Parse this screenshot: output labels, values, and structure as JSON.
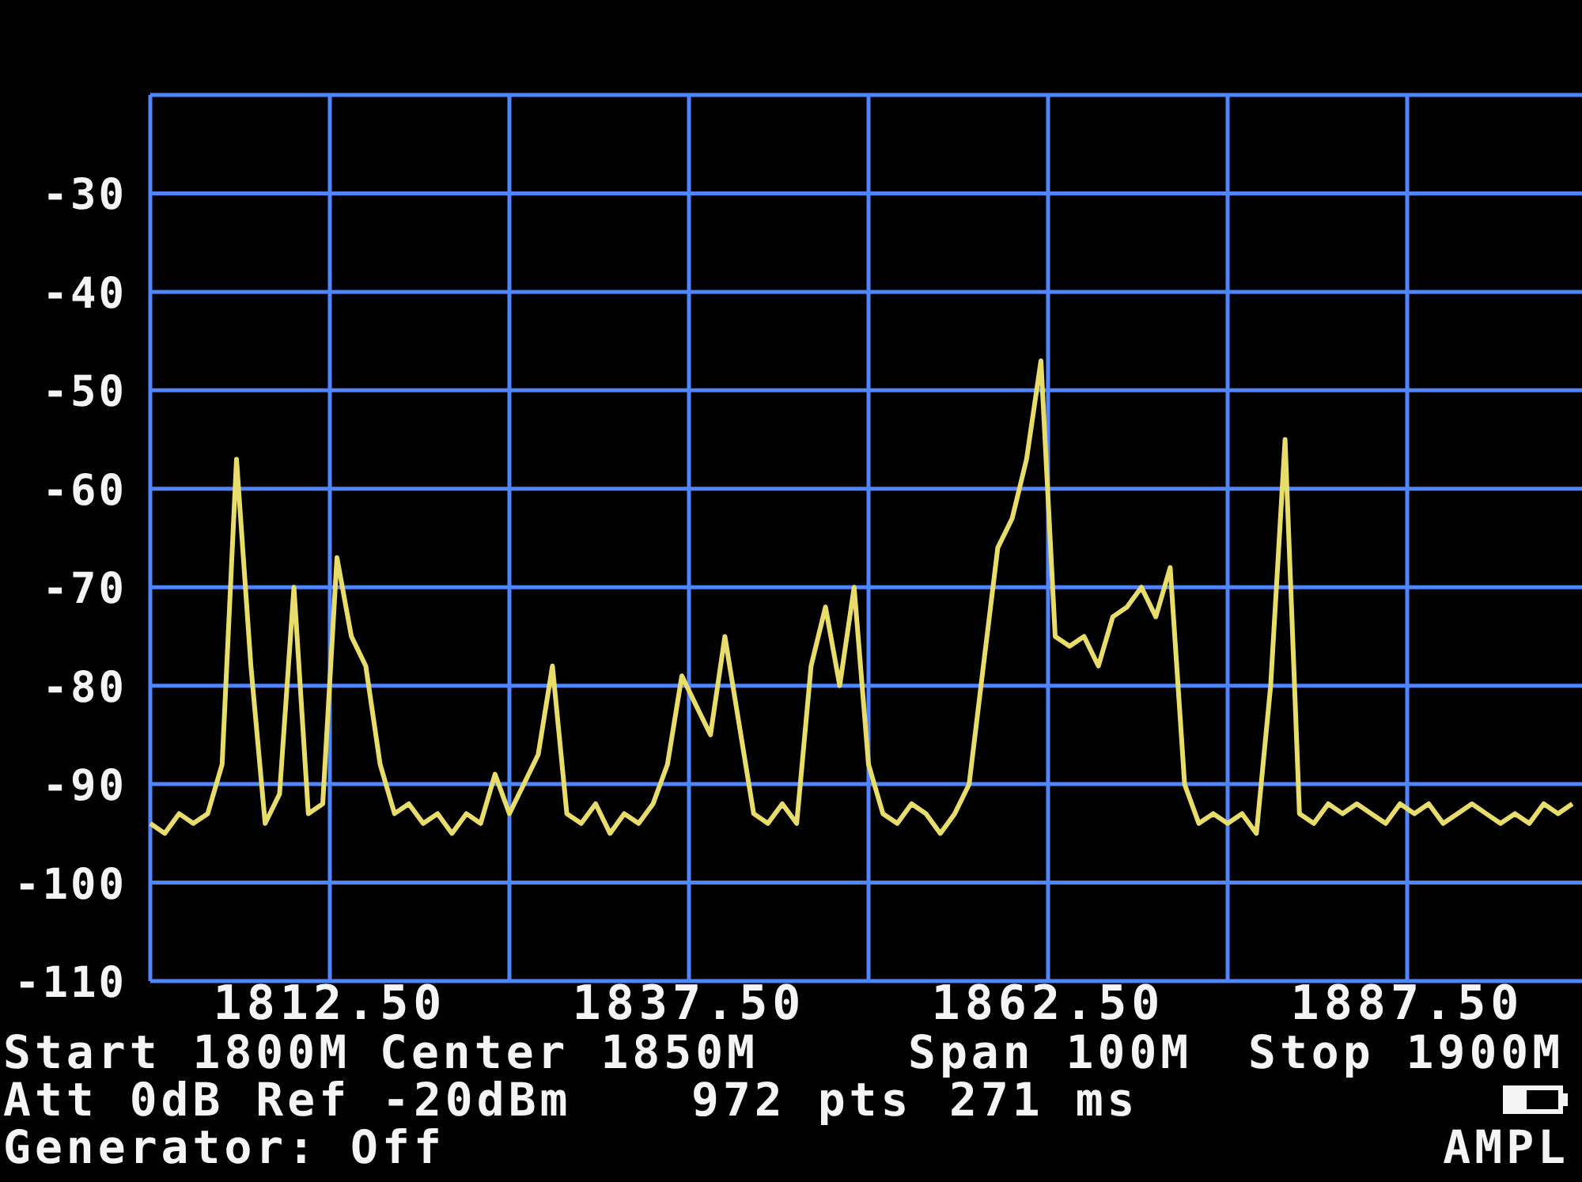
{
  "chart_data": {
    "type": "line",
    "grid": true,
    "xlim": [
      1800,
      1900
    ],
    "ylim": [
      -110,
      -20
    ],
    "yticks": [
      -30,
      -40,
      -50,
      -60,
      -70,
      -80,
      -90,
      -100,
      -110
    ],
    "xticks": [
      {
        "value": 1812.5,
        "label": "1812.50"
      },
      {
        "value": 1837.5,
        "label": "1837.50"
      },
      {
        "value": 1862.5,
        "label": "1862.50"
      },
      {
        "value": 1887.5,
        "label": "1887.50"
      }
    ],
    "x": [
      1800,
      1801,
      1802,
      1803,
      1804,
      1805,
      1806,
      1807,
      1808,
      1809,
      1810,
      1811,
      1812,
      1813,
      1814,
      1815,
      1816,
      1817,
      1818,
      1819,
      1820,
      1821,
      1822,
      1823,
      1824,
      1825,
      1826,
      1827,
      1828,
      1829,
      1830,
      1831,
      1832,
      1833,
      1834,
      1835,
      1836,
      1837,
      1838,
      1839,
      1840,
      1841,
      1842,
      1843,
      1844,
      1845,
      1846,
      1847,
      1848,
      1849,
      1850,
      1851,
      1852,
      1853,
      1854,
      1855,
      1856,
      1857,
      1858,
      1859,
      1860,
      1861,
      1862,
      1863,
      1864,
      1865,
      1866,
      1867,
      1868,
      1869,
      1870,
      1871,
      1872,
      1873,
      1874,
      1875,
      1876,
      1877,
      1878,
      1879,
      1880,
      1881,
      1882,
      1883,
      1884,
      1885,
      1886,
      1887,
      1888,
      1889,
      1890,
      1891,
      1892,
      1893,
      1894,
      1895,
      1896,
      1897,
      1898,
      1899
    ],
    "series": [
      {
        "color": "#e8dc6a",
        "values": [
          -94,
          -95,
          -93,
          -94,
          -93,
          -88,
          -57,
          -78,
          -94,
          -91,
          -70,
          -93,
          -92,
          -67,
          -75,
          -78,
          -88,
          -93,
          -92,
          -94,
          -93,
          -95,
          -93,
          -94,
          -89,
          -93,
          -90,
          -87,
          -78,
          -93,
          -94,
          -92,
          -95,
          -93,
          -94,
          -92,
          -88,
          -79,
          -82,
          -85,
          -75,
          -84,
          -93,
          -94,
          -92,
          -94,
          -78,
          -72,
          -80,
          -70,
          -88,
          -93,
          -94,
          -92,
          -93,
          -95,
          -93,
          -90,
          -78,
          -66,
          -63,
          -57,
          -47,
          -75,
          -76,
          -75,
          -78,
          -73,
          -72,
          -70,
          -73,
          -68,
          -90,
          -94,
          -93,
          -94,
          -93,
          -95,
          -80,
          -55,
          -93,
          -94,
          -92,
          -93,
          -92,
          -93,
          -94,
          -92,
          -93,
          -92,
          -94,
          -93,
          -92,
          -93,
          -94,
          -93,
          -94,
          -92,
          -93,
          -92
        ]
      }
    ]
  },
  "status": {
    "start": "Start 1800M",
    "center": "Center 1850M",
    "span": "Span 100M",
    "stop": "Stop 1900M",
    "att_ref": "Att 0dB Ref -20dBm",
    "points": "972 pts",
    "sweep_time": "271 ms",
    "generator": "Generator: Off",
    "mode": "AMPL"
  }
}
